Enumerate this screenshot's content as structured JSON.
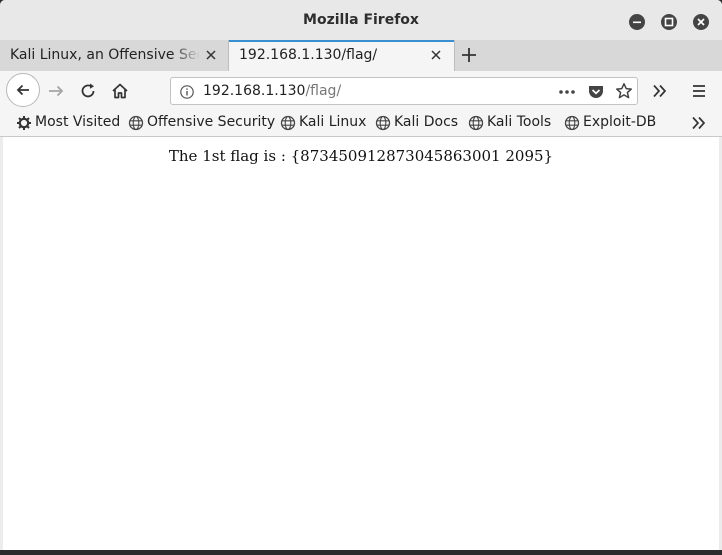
{
  "window": {
    "title": "Mozilla Firefox"
  },
  "tabs": [
    {
      "label": "Kali Linux, an Offensive Security"
    },
    {
      "label": "192.168.1.130/flag/"
    }
  ],
  "urlbar": {
    "host": "192.168.1.130",
    "path": "/flag/"
  },
  "bookmarks": [
    {
      "label": "Most Visited",
      "icon": "gear-icon"
    },
    {
      "label": "Offensive Security",
      "icon": "globe-icon"
    },
    {
      "label": "Kali Linux",
      "icon": "globe-icon"
    },
    {
      "label": "Kali Docs",
      "icon": "globe-icon"
    },
    {
      "label": "Kali Tools",
      "icon": "globe-icon"
    },
    {
      "label": "Exploit-DB",
      "icon": "globe-icon"
    }
  ],
  "page": {
    "text": "The 1st flag is : {873450912873045863001 2095}"
  },
  "colors": {
    "accent": "#3a8fd1",
    "chrome": "#f5f5f5",
    "titlebar": "#e8e8e8"
  }
}
